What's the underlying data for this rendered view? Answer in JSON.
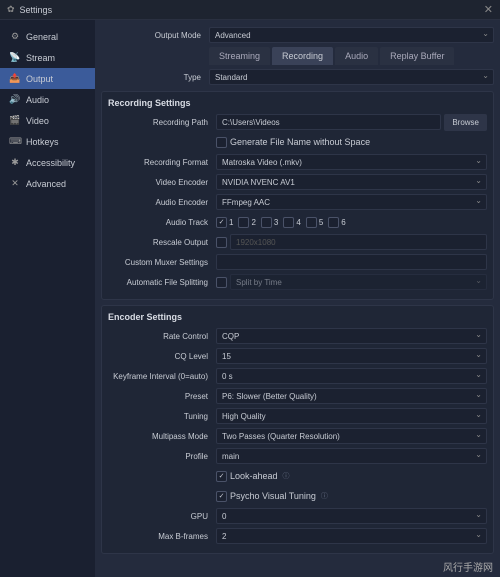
{
  "window": {
    "title": "Settings"
  },
  "sidebar": {
    "items": [
      {
        "icon": "⚙",
        "label": "General"
      },
      {
        "icon": "📡",
        "label": "Stream"
      },
      {
        "icon": "📤",
        "label": "Output"
      },
      {
        "icon": "🔊",
        "label": "Audio"
      },
      {
        "icon": "🎬",
        "label": "Video"
      },
      {
        "icon": "⌨",
        "label": "Hotkeys"
      },
      {
        "icon": "✱",
        "label": "Accessibility"
      },
      {
        "icon": "✕",
        "label": "Advanced"
      }
    ]
  },
  "outputMode": {
    "label": "Output Mode",
    "value": "Advanced"
  },
  "tabs": [
    "Streaming",
    "Recording",
    "Audio",
    "Replay Buffer"
  ],
  "type": {
    "label": "Type",
    "value": "Standard"
  },
  "recSection": {
    "title": "Recording Settings",
    "fields": {
      "path": {
        "label": "Recording Path",
        "value": "C:\\Users\\Videos",
        "btn": "Browse"
      },
      "genNoSpace": {
        "label": "Generate File Name without Space"
      },
      "format": {
        "label": "Recording Format",
        "value": "Matroska Video (.mkv)"
      },
      "venc": {
        "label": "Video Encoder",
        "value": "NVIDIA NVENC AV1"
      },
      "aenc": {
        "label": "Audio Encoder",
        "value": "FFmpeg AAC"
      },
      "tracks": {
        "label": "Audio Track",
        "n": [
          "1",
          "2",
          "3",
          "4",
          "5",
          "6"
        ]
      },
      "rescale": {
        "label": "Rescale Output",
        "value": "1920x1080"
      },
      "muxer": {
        "label": "Custom Muxer Settings"
      },
      "split": {
        "label": "Automatic File Splitting",
        "value": "Split by Time"
      }
    }
  },
  "encSection": {
    "title": "Encoder Settings",
    "fields": {
      "rc": {
        "label": "Rate Control",
        "value": "CQP"
      },
      "cq": {
        "label": "CQ Level",
        "value": "15"
      },
      "kf": {
        "label": "Keyframe Interval (0=auto)",
        "value": "0 s"
      },
      "preset": {
        "label": "Preset",
        "value": "P6: Slower (Better Quality)"
      },
      "tuning": {
        "label": "Tuning",
        "value": "High Quality"
      },
      "multi": {
        "label": "Multipass Mode",
        "value": "Two Passes (Quarter Resolution)"
      },
      "profile": {
        "label": "Profile",
        "value": "main"
      },
      "look": {
        "label": "Look-ahead"
      },
      "psy": {
        "label": "Psycho Visual Tuning"
      },
      "gpu": {
        "label": "GPU",
        "value": "0"
      },
      "bf": {
        "label": "Max B-frames",
        "value": "2"
      }
    }
  },
  "watermark": "风行手游网"
}
